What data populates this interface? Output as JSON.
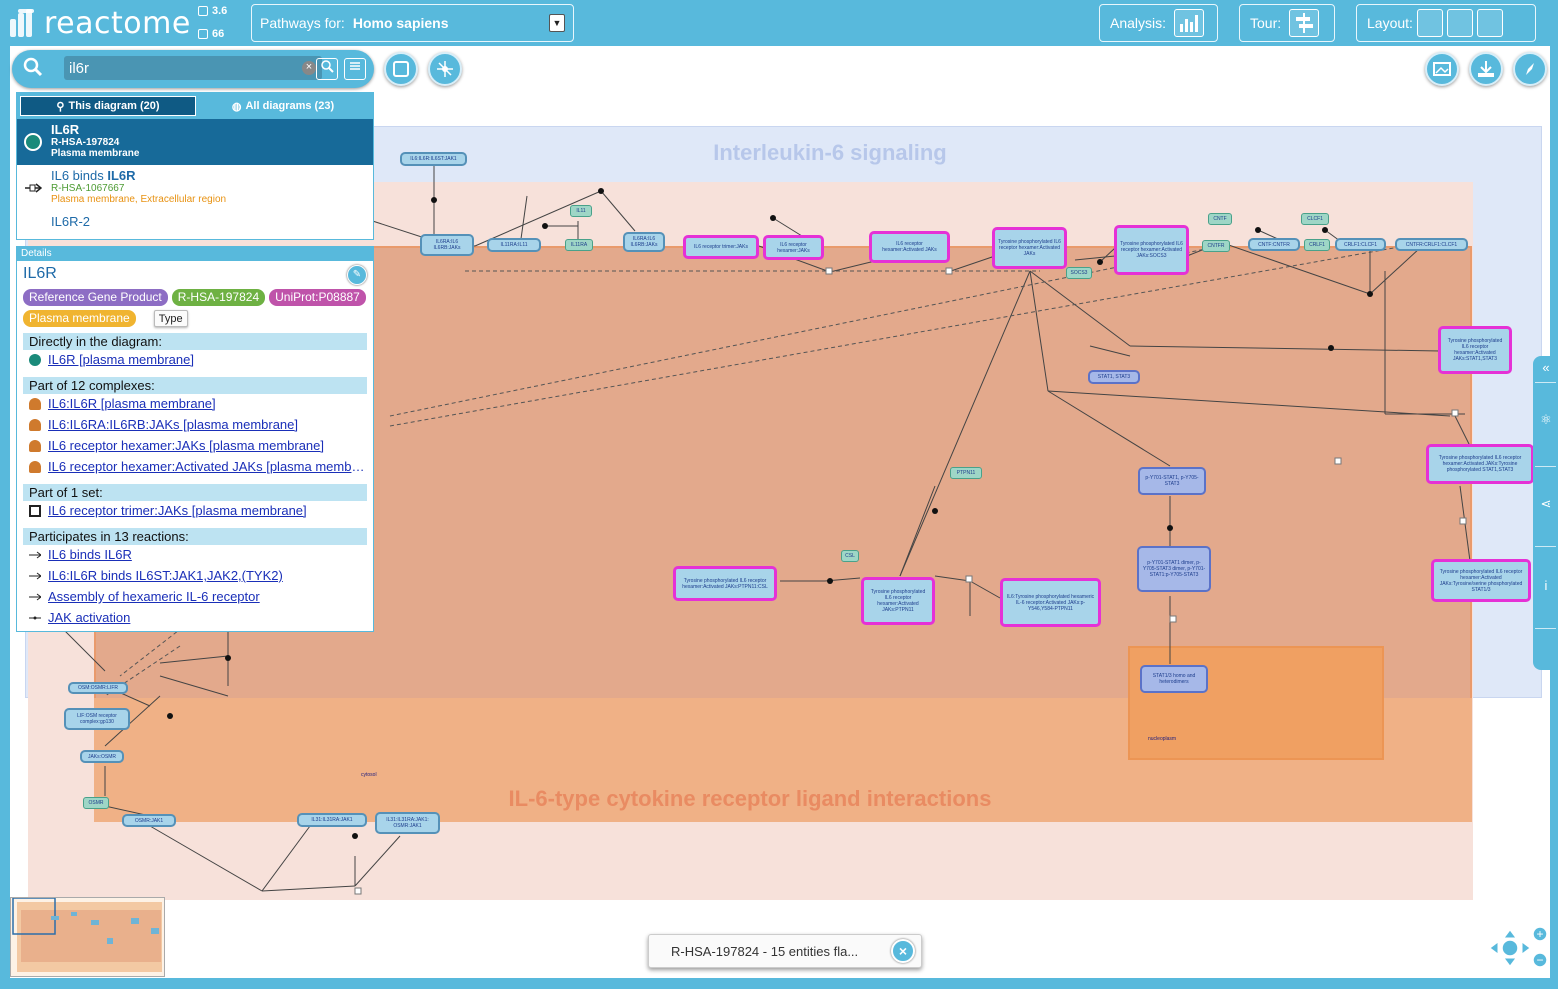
{
  "app": {
    "logo_text": "reactome",
    "version_value": "3.6",
    "db_value": "66"
  },
  "topbar": {
    "pathways_label": "Pathways for:",
    "species": "Homo sapiens",
    "analysis_label": "Analysis:",
    "tour_label": "Tour:",
    "layout_label": "Layout:"
  },
  "search": {
    "value": "il6r"
  },
  "results": {
    "tabs": [
      {
        "label": "This diagram (20)",
        "active": true
      },
      {
        "label": "All diagrams (23)",
        "active": false
      }
    ],
    "items": [
      {
        "name": "IL6R",
        "id": "R-HSA-197824",
        "location": "Plasma membrane",
        "selected": true,
        "icon": "entity-circle-icon"
      },
      {
        "name_pre": "IL6 binds ",
        "name_hl": "IL6R",
        "id": "R-HSA-1067667",
        "location": "Plasma membrane, Extracellular region",
        "icon": "reaction-icon"
      },
      {
        "name": "IL6R-2"
      }
    ]
  },
  "details": {
    "header": "Details",
    "name": "IL6R",
    "tags": [
      {
        "label": "Reference Gene Product",
        "color": "#8d6dc4"
      },
      {
        "label": "R-HSA-197824",
        "color": "#6eb143"
      },
      {
        "label": "UniProt:P08887",
        "color": "#bf53aa"
      },
      {
        "label": "Plasma membrane",
        "color": "#f0b430"
      }
    ],
    "tooltip": "Type",
    "sections": {
      "direct": {
        "title": "Directly in the diagram:",
        "items": [
          "IL6R [plasma membrane]"
        ]
      },
      "complexes": {
        "title": "Part of 12 complexes:",
        "items": [
          "IL6:IL6R [plasma membrane]",
          "IL6:IL6RA:IL6RB:JAKs [plasma membrane]",
          "IL6 receptor hexamer:JAKs [plasma membrane]",
          "IL6 receptor hexamer:Activated JAKs [plasma membrane]"
        ]
      },
      "sets": {
        "title": "Part of 1 set:",
        "items": [
          "IL6 receptor trimer:JAKs [plasma membrane]"
        ]
      },
      "reactions": {
        "title": "Participates in 13 reactions:",
        "items": [
          "IL6 binds IL6R",
          "IL6:IL6R binds IL6ST:JAK1,JAK2,(TYK2)",
          "Assembly of hexameric IL-6 receptor",
          "JAK activation"
        ]
      }
    }
  },
  "diagram": {
    "compartment_titles": {
      "il6_signaling": "Interleukin-6 signaling",
      "il6_type": "IL-6-type cytokine receptor ligand interactions"
    },
    "labels": {
      "cytosol": "cytosol",
      "nucleoplasm": "nucleoplasm"
    },
    "nodes": [
      {
        "key": "n1",
        "text": "IL6:IL6R:IL6ST:JAK1 ..."
      },
      {
        "key": "n2",
        "text": "IL6RA:IL6 IL6RB:JAKs"
      },
      {
        "key": "n3",
        "text": "IL6:sIL6R:IL6RB: JAKs"
      },
      {
        "key": "n4",
        "text": "IL11RA:IL11"
      },
      {
        "key": "n5",
        "text": "IL11RA"
      },
      {
        "key": "n6",
        "text": "IL11"
      },
      {
        "key": "n7",
        "text": "IL6RA:IL6 IL6RB:JAKs"
      },
      {
        "key": "n8",
        "text": "IL6 receptor trimer:JAKs"
      },
      {
        "key": "n9",
        "text": "IL6 receptor hexamer:JAKs"
      },
      {
        "key": "n10",
        "text": "IL6 receptor hexamer:Activated JAKs"
      },
      {
        "key": "n11",
        "text": "Tyrosine phosphorylated IL6 receptor hexamer:Activated JAKs"
      },
      {
        "key": "n12",
        "text": "Tyrosine phosphorylated IL6 receptor hexamer:Activated JAKs:SOCS3"
      },
      {
        "key": "n13",
        "text": "SOCS3"
      },
      {
        "key": "n14",
        "text": "CNTF"
      },
      {
        "key": "n15",
        "text": "CNTFR"
      },
      {
        "key": "n16",
        "text": "CNTF:CNTFR"
      },
      {
        "key": "n17",
        "text": "CLCF1"
      },
      {
        "key": "n18",
        "text": "CRLF1"
      },
      {
        "key": "n19",
        "text": "CRLF1:CLCF1"
      },
      {
        "key": "n20",
        "text": "CNTFR:CRLF1:CLCF1"
      },
      {
        "key": "n21",
        "text": "Tyrosine phosphorylated IL6 receptor hexamer:Activated JAKs:STAT1,STAT3"
      },
      {
        "key": "n22",
        "text": "STAT1, STAT3"
      },
      {
        "key": "n23",
        "text": "Tyrosine phosphorylated IL6 receptor hexamer:Activated JAKs:Tyrosine phosphorylated STAT1,STAT3"
      },
      {
        "key": "n24",
        "text": "PTPN11"
      },
      {
        "key": "n25",
        "text": "p-Y701-STAT1, p-Y705-STAT3"
      },
      {
        "key": "n26",
        "text": "Tyrosine phosphorylated IL6 receptor hexamer:Activated JAKs:Tyrosine/serine phosphorylated STAT1/3"
      },
      {
        "key": "n27",
        "text": "CSL"
      },
      {
        "key": "n28",
        "text": "Tyrosine phosphorylated IL6 receptor hexamer:Activated JAKs:PTPN11:CSL"
      },
      {
        "key": "n29",
        "text": "Tyrosine phosphorylated IL6 receptor hexamer:Activated JAKs:PTPN11"
      },
      {
        "key": "n30",
        "text": "IL6:Tyrosine phosphorylated hexameric IL-6 receptor:Activated JAKs:p-Y546,Y584-PTPN11"
      },
      {
        "key": "n31",
        "text": "p-Y701-STAT1 dimer, p-Y705-STAT3 dimer, p-Y701-STAT1:p-Y705-STAT3"
      },
      {
        "key": "n32",
        "text": "STAT1/3 homo and heterodimers"
      },
      {
        "key": "n33",
        "text": "OSM:OSMR:LIFR"
      },
      {
        "key": "n34",
        "text": "LIF:OSM receptor complex:gp130"
      },
      {
        "key": "n35",
        "text": "JAKs:OSMR"
      },
      {
        "key": "n36",
        "text": "OSMR"
      },
      {
        "key": "n37",
        "text": "OSMR:JAK1"
      },
      {
        "key": "n38",
        "text": "IL31:IL31RA:JAK1"
      },
      {
        "key": "n39",
        "text": "IL31:IL31RA:JAK1: OSMR:JAK1"
      },
      {
        "key": "n40",
        "text": "IL6:IL6R:IL6ST:JAK1"
      }
    ]
  },
  "notification": {
    "text": "R-HSA-197824 - 15 entities fla..."
  },
  "colors": {
    "brand": "#58b9dc",
    "selected": "#176a99",
    "highlight": "#e531d6"
  }
}
